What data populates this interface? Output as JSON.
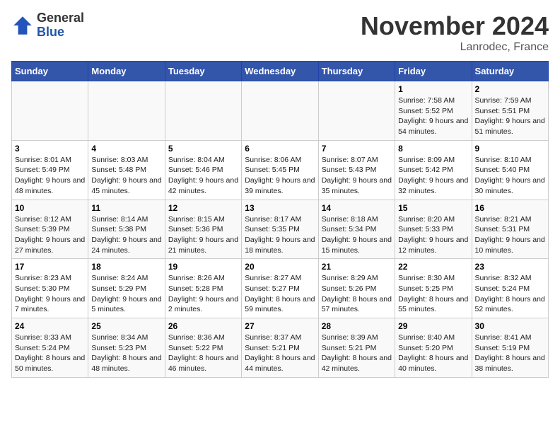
{
  "header": {
    "logo_general": "General",
    "logo_blue": "Blue",
    "month_title": "November 2024",
    "location": "Lanrodec, France"
  },
  "weekdays": [
    "Sunday",
    "Monday",
    "Tuesday",
    "Wednesday",
    "Thursday",
    "Friday",
    "Saturday"
  ],
  "weeks": [
    [
      {
        "day": "",
        "info": ""
      },
      {
        "day": "",
        "info": ""
      },
      {
        "day": "",
        "info": ""
      },
      {
        "day": "",
        "info": ""
      },
      {
        "day": "",
        "info": ""
      },
      {
        "day": "1",
        "info": "Sunrise: 7:58 AM\nSunset: 5:52 PM\nDaylight: 9 hours and 54 minutes."
      },
      {
        "day": "2",
        "info": "Sunrise: 7:59 AM\nSunset: 5:51 PM\nDaylight: 9 hours and 51 minutes."
      }
    ],
    [
      {
        "day": "3",
        "info": "Sunrise: 8:01 AM\nSunset: 5:49 PM\nDaylight: 9 hours and 48 minutes."
      },
      {
        "day": "4",
        "info": "Sunrise: 8:03 AM\nSunset: 5:48 PM\nDaylight: 9 hours and 45 minutes."
      },
      {
        "day": "5",
        "info": "Sunrise: 8:04 AM\nSunset: 5:46 PM\nDaylight: 9 hours and 42 minutes."
      },
      {
        "day": "6",
        "info": "Sunrise: 8:06 AM\nSunset: 5:45 PM\nDaylight: 9 hours and 39 minutes."
      },
      {
        "day": "7",
        "info": "Sunrise: 8:07 AM\nSunset: 5:43 PM\nDaylight: 9 hours and 35 minutes."
      },
      {
        "day": "8",
        "info": "Sunrise: 8:09 AM\nSunset: 5:42 PM\nDaylight: 9 hours and 32 minutes."
      },
      {
        "day": "9",
        "info": "Sunrise: 8:10 AM\nSunset: 5:40 PM\nDaylight: 9 hours and 30 minutes."
      }
    ],
    [
      {
        "day": "10",
        "info": "Sunrise: 8:12 AM\nSunset: 5:39 PM\nDaylight: 9 hours and 27 minutes."
      },
      {
        "day": "11",
        "info": "Sunrise: 8:14 AM\nSunset: 5:38 PM\nDaylight: 9 hours and 24 minutes."
      },
      {
        "day": "12",
        "info": "Sunrise: 8:15 AM\nSunset: 5:36 PM\nDaylight: 9 hours and 21 minutes."
      },
      {
        "day": "13",
        "info": "Sunrise: 8:17 AM\nSunset: 5:35 PM\nDaylight: 9 hours and 18 minutes."
      },
      {
        "day": "14",
        "info": "Sunrise: 8:18 AM\nSunset: 5:34 PM\nDaylight: 9 hours and 15 minutes."
      },
      {
        "day": "15",
        "info": "Sunrise: 8:20 AM\nSunset: 5:33 PM\nDaylight: 9 hours and 12 minutes."
      },
      {
        "day": "16",
        "info": "Sunrise: 8:21 AM\nSunset: 5:31 PM\nDaylight: 9 hours and 10 minutes."
      }
    ],
    [
      {
        "day": "17",
        "info": "Sunrise: 8:23 AM\nSunset: 5:30 PM\nDaylight: 9 hours and 7 minutes."
      },
      {
        "day": "18",
        "info": "Sunrise: 8:24 AM\nSunset: 5:29 PM\nDaylight: 9 hours and 5 minutes."
      },
      {
        "day": "19",
        "info": "Sunrise: 8:26 AM\nSunset: 5:28 PM\nDaylight: 9 hours and 2 minutes."
      },
      {
        "day": "20",
        "info": "Sunrise: 8:27 AM\nSunset: 5:27 PM\nDaylight: 8 hours and 59 minutes."
      },
      {
        "day": "21",
        "info": "Sunrise: 8:29 AM\nSunset: 5:26 PM\nDaylight: 8 hours and 57 minutes."
      },
      {
        "day": "22",
        "info": "Sunrise: 8:30 AM\nSunset: 5:25 PM\nDaylight: 8 hours and 55 minutes."
      },
      {
        "day": "23",
        "info": "Sunrise: 8:32 AM\nSunset: 5:24 PM\nDaylight: 8 hours and 52 minutes."
      }
    ],
    [
      {
        "day": "24",
        "info": "Sunrise: 8:33 AM\nSunset: 5:24 PM\nDaylight: 8 hours and 50 minutes."
      },
      {
        "day": "25",
        "info": "Sunrise: 8:34 AM\nSunset: 5:23 PM\nDaylight: 8 hours and 48 minutes."
      },
      {
        "day": "26",
        "info": "Sunrise: 8:36 AM\nSunset: 5:22 PM\nDaylight: 8 hours and 46 minutes."
      },
      {
        "day": "27",
        "info": "Sunrise: 8:37 AM\nSunset: 5:21 PM\nDaylight: 8 hours and 44 minutes."
      },
      {
        "day": "28",
        "info": "Sunrise: 8:39 AM\nSunset: 5:21 PM\nDaylight: 8 hours and 42 minutes."
      },
      {
        "day": "29",
        "info": "Sunrise: 8:40 AM\nSunset: 5:20 PM\nDaylight: 8 hours and 40 minutes."
      },
      {
        "day": "30",
        "info": "Sunrise: 8:41 AM\nSunset: 5:19 PM\nDaylight: 8 hours and 38 minutes."
      }
    ]
  ]
}
